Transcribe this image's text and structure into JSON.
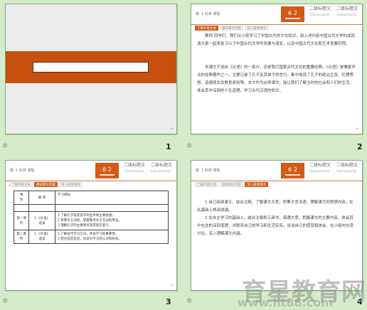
{
  "slides": [
    {
      "number": "1",
      "title_box": ""
    },
    {
      "number": "2",
      "header": {
        "meta": "1 标准 课程",
        "logo": "6 2",
        "title1": "二级标题文",
        "title2": "二级标题文",
        "sub1": "内容内容内容内容",
        "sub2": "内容内容内容内容"
      },
      "tabs": [
        "了解作者文体",
        "感知课文内容",
        "深入研读课文"
      ],
      "paragraphs": [
        "教师:同学们，我们从小就学习了中国古代的文化知识，如上述内容中国古代文学的成就,请大家一起来复习以下中国古代文学的发展与演变，以及中国古代文化和艺术发展历程。",
        "本课文节选自《论语》的一部分，这是我们国家古代文化的重要经典。《论语》是儒家学派的经典著作之一，主要记录了孔子及其弟子的言行，集中体现了孔子的政治主张、伦理思想、道德观念及教育原则等。本文作为必修课文，能让我们了解当时的社会和人们的生活，体会其中深刻的人生道理，学习古代汉语的知识。"
      ]
    },
    {
      "number": "3",
      "header": {
        "meta": "1 标准 课程",
        "logo": "6 2",
        "title1": "二级标题文",
        "title2": "二级标题文",
        "sub1": "内容内容内容内容",
        "sub2": "内容内容内容内容"
      },
      "tabs": [
        "了解作者文体",
        "感知课文内容",
        "深入研读课文"
      ],
      "table": [
        [
          "课\n时",
          "篇 目",
          "学习目标"
        ],
        [
          "",
          "",
          ""
        ],
        [
          "第一课时",
          "1 《论语》\n选读",
          "1 了解孔子及其弟子的生平和主要思想。\n2 积累文言词语，掌握重点文言实词的用法。\n3 理解孔子的主要观点及其现实意义。"
        ],
        [
          "第二课时",
          "2 《论语》\n选读",
          "1 了解古代学习方法，体会学习的重要性。\n2 结合现实生活，谈谈对学习的认识和体会。"
        ]
      ]
    },
    {
      "number": "4",
      "header": {
        "meta": "1 标准 课程",
        "logo": "6 2",
        "title1": "二级标题文",
        "title2": "二级标题文",
        "sub1": "内容内容内容内容",
        "sub2": "内容内容内容内容"
      },
      "tabs": [
        "了解作者文体",
        "感知课文内容",
        "深入研读课文"
      ],
      "paragraphs": [
        "1 自己阅读课文，结合注释，了解课文大意，积累文言词语，理解课文的思想内容，在此基础上熟读成诵。",
        "2 在自主学习的基础上，结合注释和工具书，疏通文意，把握课文的主要内容，体会其中包含的深刻道理，并联系自己的学习和生活实际，谈谈自己的感受和体会，在小组内交流讨论，深入理解课文内涵。"
      ]
    }
  ],
  "watermark": {
    "text": "育星教育网",
    "url": "www.ht88.com"
  }
}
